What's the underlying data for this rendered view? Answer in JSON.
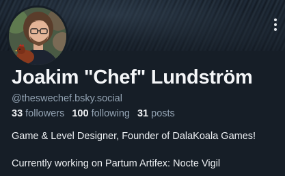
{
  "profile": {
    "display_name": "Joakim \"Chef\" Lundström",
    "handle": "@theswechef.bsky.social",
    "stats": {
      "followers_count": "33",
      "followers_label": "followers",
      "following_count": "100",
      "following_label": "following",
      "posts_count": "31",
      "posts_label": "posts"
    },
    "bio": [
      "Game & Level Designer, Founder of DalaKoala Games!",
      "Currently working on Partum Artifex: Nocte Vigil"
    ],
    "menu_icon": "more-vertical-icon"
  },
  "colors": {
    "background": "#161e27",
    "text_primary": "#f1f3f5",
    "text_secondary": "#93a3b3"
  }
}
